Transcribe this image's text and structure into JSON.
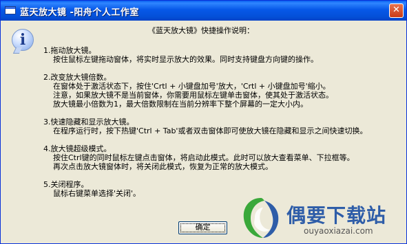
{
  "window": {
    "title": "蓝天放大镜 -阳舟个人工作室",
    "close_label": "✕",
    "info_glyph": "i"
  },
  "dialog": {
    "heading": "《蓝天放大镜》快捷操作说明：",
    "items": [
      {
        "title": "1.拖动放大镜。",
        "lines": [
          "按住鼠标左键拖动窗体，将实时显示放大的效果。同时支持键盘方向键的操作。"
        ]
      },
      {
        "title": "2.改变放大镜倍数。",
        "lines": [
          "在窗体处于激活状态下，按住'Crtl + 小键盘加号'放大，'Crtl + 小键盘加号'缩小。",
          "注意，如果放大镜不是当前窗体，你需要用鼠标左键单击窗体，使其处于激活状态。",
          "放大镜最小倍数为1，最大倍数限制在当前分辨率下整个屏幕的一定大小内。"
        ]
      },
      {
        "title": "3.快速隐藏和显示放大镜。",
        "lines": [
          "在程序运行时，按下热键'Ctrl + Tab'或者双击窗体即可使放大镜在隐藏和显示之间快速切换。"
        ]
      },
      {
        "title": "4.放大镜超级模式。",
        "lines": [
          "按住Ctrl键的同时鼠标左键点击窗体，将启动此模式。此时可以放大查看菜单、下拉框等。",
          "再次点击放大镜窗体时，将关闭此模式，恢复为正常的放大模式。"
        ]
      },
      {
        "title": "5.关闭程序。",
        "lines": [
          "鼠标右键菜单选择'关闭'。"
        ]
      }
    ],
    "ok_label": "确定"
  },
  "watermark": {
    "text": "偶要下载站",
    "url": "ouyaoxiazai.com"
  },
  "colors": {
    "titlebar": "#0758e8",
    "dialog_bg": "#ece9d8",
    "close_button": "#c93a16",
    "watermark_blue": "#2e5da8",
    "watermark_green": "#3aa83a"
  }
}
